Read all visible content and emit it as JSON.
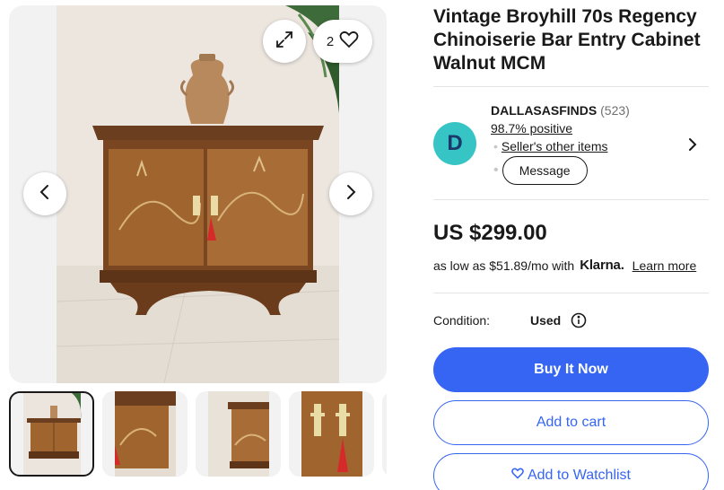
{
  "gallery": {
    "favorite_count": "2",
    "thumbnails": [
      "cabinet-front",
      "cabinet-top-corner",
      "cabinet-side",
      "brass-pulls-tassel"
    ],
    "icons": {
      "expand": "expand-icon",
      "favorite": "heart-icon",
      "prev": "chevron-left-icon",
      "next": "chevron-right-icon"
    }
  },
  "listing": {
    "title": "Vintage Broyhill 70s Regency Chinoiserie Bar Entry Cabinet Walnut MCM",
    "price": "US $299.00",
    "financing": {
      "prefix": "as low as $51.89/mo with",
      "provider": "Klarna.",
      "learn_more": "Learn more"
    },
    "condition": {
      "label": "Condition:",
      "value": "Used"
    }
  },
  "seller": {
    "avatar_letter": "D",
    "name": "DALLASASFINDS",
    "feedback_count": "(523)",
    "positive": "98.7% positive",
    "other_items": "Seller's other items",
    "message": "Message"
  },
  "actions": {
    "buy_now": "Buy It Now",
    "add_to_cart": "Add to cart",
    "add_to_watchlist": "Add to Watchlist"
  },
  "colors": {
    "primary": "#3665f3",
    "avatar_bg": "#36c4c4",
    "text": "#191919"
  }
}
